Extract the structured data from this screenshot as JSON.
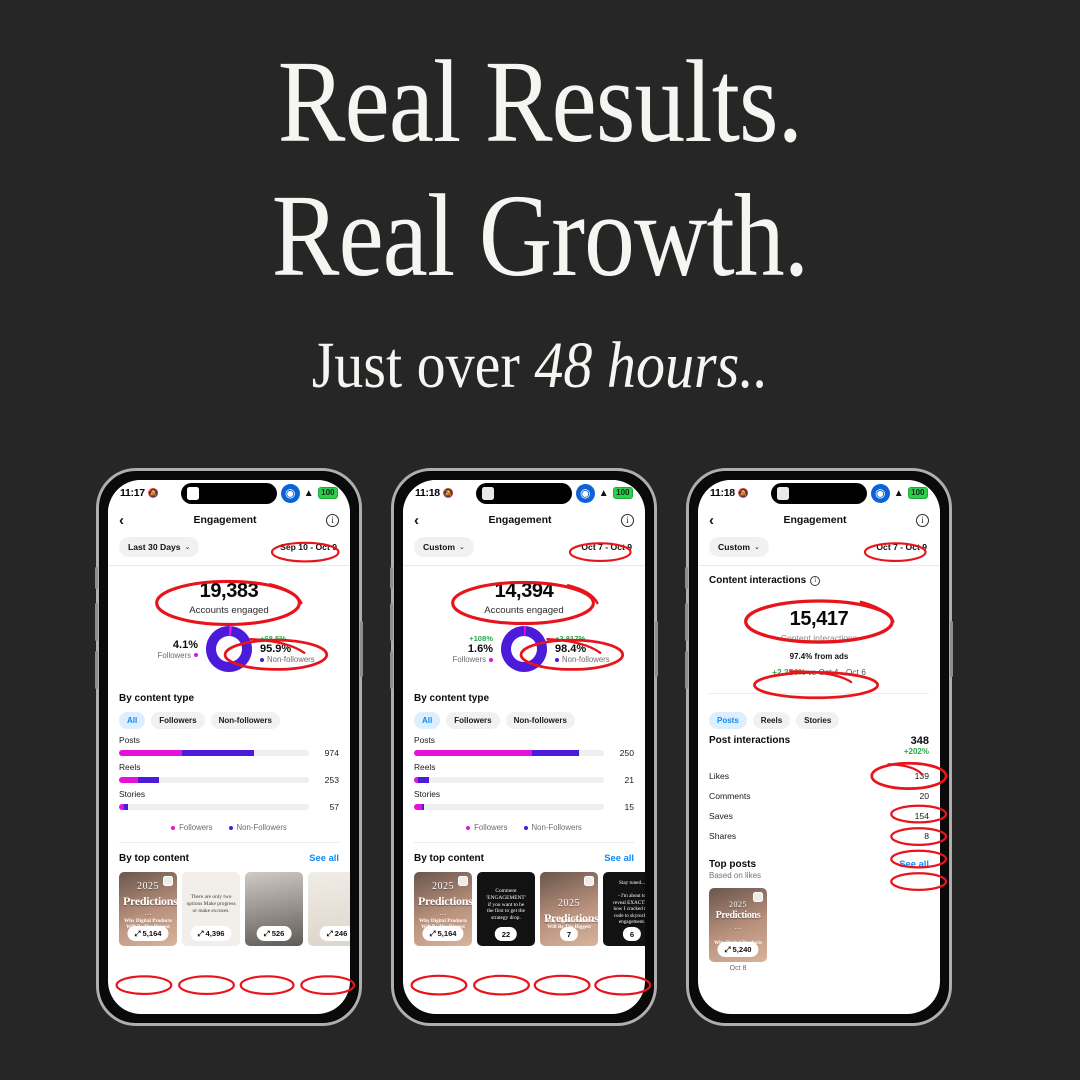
{
  "headline": {
    "line1": "Real Results.",
    "line2": "Real Growth.",
    "sub_prefix": "Just over ",
    "sub_emphasis": "48 hours.."
  },
  "colors": {
    "background": "#262626",
    "annotation": "#e8141b",
    "magenta": "#e612d9",
    "blue": "#4b1bd9",
    "green": "#2aa84a",
    "link": "#0b8bf5"
  },
  "phones": [
    {
      "status": {
        "time": "11:17",
        "mute_icon": "mute-bell-icon",
        "airdrop_icon": "airdrop-icon",
        "wifi_icon": "wifi-icon",
        "battery": "100"
      },
      "nav": {
        "back_icon": "chevron-left-icon",
        "title": "Engagement",
        "info_icon": "info-icon"
      },
      "filter": {
        "preset": "Last 30 Days",
        "chevron": "chevron-down-icon",
        "date_range": "Sep 10 - Oct 9"
      },
      "hero": {
        "value": "19,383",
        "label": "Accounts engaged"
      },
      "donut": {
        "left": {
          "pct": "4.1%",
          "label": "Followers",
          "delta": ""
        },
        "right": {
          "pct": "95.9%",
          "label": "Non-followers",
          "delta": "+68.5%"
        },
        "followers_share": 4.1
      },
      "content_type": {
        "title": "By content type",
        "tabs": [
          "All",
          "Followers",
          "Non-followers"
        ],
        "active_tab": "All",
        "rows": [
          {
            "label": "Posts",
            "value": "974",
            "followers_pct": 33,
            "nonfollowers_pct": 38
          },
          {
            "label": "Reels",
            "value": "253",
            "followers_pct": 10,
            "nonfollowers_pct": 11
          },
          {
            "label": "Stories",
            "value": "57",
            "followers_pct": 2.5,
            "nonfollowers_pct": 2
          }
        ],
        "legend": [
          "Followers",
          "Non-Followers"
        ]
      },
      "top_content": {
        "title": "By top content",
        "see_all": "See all",
        "items": [
          {
            "style": "t-predict",
            "big": "2025",
            "big2": "Predictions",
            "sub": "Why Digital Products Will Be The Biggest",
            "badge": "5,164",
            "trend_icon": "trend-up-icon",
            "carousel": true
          },
          {
            "style": "t-light",
            "text": "There are only two options\nMake progress or\nmake excuses.",
            "badge": "4,396",
            "trend_icon": "trend-up-icon",
            "carousel": false
          },
          {
            "style": "t-photo",
            "text": "",
            "badge": "526",
            "trend_icon": "trend-up-icon",
            "carousel": false
          },
          {
            "style": "t-room",
            "text": "",
            "badge": "246",
            "trend_icon": "trend-up-icon",
            "carousel": false
          },
          {
            "style": "t-room",
            "text": "",
            "badge": "",
            "trend_icon": "",
            "carousel": false
          }
        ]
      }
    },
    {
      "status": {
        "time": "11:18",
        "mute_icon": "mute-bell-icon",
        "airdrop_icon": "airdrop-icon",
        "wifi_icon": "wifi-icon",
        "battery": "100"
      },
      "nav": {
        "back_icon": "chevron-left-icon",
        "title": "Engagement",
        "info_icon": "info-icon"
      },
      "filter": {
        "preset": "Custom",
        "chevron": "chevron-down-icon",
        "date_range": "Oct 7 - Oct 9"
      },
      "hero": {
        "value": "14,394",
        "label": "Accounts engaged"
      },
      "donut": {
        "left": {
          "pct": "1.6%",
          "label": "Followers",
          "delta": "+108%"
        },
        "right": {
          "pct": "98.4%",
          "label": "Non-followers",
          "delta": "+3,817%"
        },
        "followers_share": 1.6
      },
      "content_type": {
        "title": "By content type",
        "tabs": [
          "All",
          "Followers",
          "Non-followers"
        ],
        "active_tab": "All",
        "rows": [
          {
            "label": "Posts",
            "value": "250",
            "followers_pct": 62,
            "nonfollowers_pct": 25
          },
          {
            "label": "Reels",
            "value": "21",
            "followers_pct": 2,
            "nonfollowers_pct": 6
          },
          {
            "label": "Stories",
            "value": "15",
            "followers_pct": 4,
            "nonfollowers_pct": 1.5
          }
        ],
        "legend": [
          "Followers",
          "Non-Followers"
        ]
      },
      "top_content": {
        "title": "By top content",
        "see_all": "See all",
        "items": [
          {
            "style": "t-predict",
            "big": "2025",
            "big2": "Predictions",
            "sub": "Why Digital Products Will Be The Biggest",
            "badge": "5,164",
            "trend_icon": "trend-up-icon",
            "carousel": true
          },
          {
            "style": "t-dark",
            "text": "Comment\n'ENGAGEMENT'\nif you want to be\nthe first to get the\nstrategy drop.",
            "badge": "22",
            "trend_icon": "",
            "carousel": false
          },
          {
            "style": "t-predict2",
            "big": "2025",
            "big2": "Predictions",
            "sub": "Why Digital Products Will Be The Biggest",
            "badge": "7",
            "trend_icon": "",
            "carousel": true
          },
          {
            "style": "t-dark",
            "text": "Stay tuned...\n\n- I'm about to\nreveal EXACTLY\nhow I cracked the\ncode to skyrocket\nengagement.",
            "badge": "6",
            "trend_icon": "",
            "carousel": false
          },
          {
            "style": "t-dark",
            "text": "",
            "badge": "",
            "trend_icon": "",
            "carousel": false
          }
        ]
      }
    },
    {
      "status": {
        "time": "11:18",
        "mute_icon": "mute-bell-icon",
        "airdrop_icon": "airdrop-icon",
        "wifi_icon": "wifi-icon",
        "battery": "100"
      },
      "nav": {
        "back_icon": "chevron-left-icon",
        "title": "Engagement",
        "info_icon": "info-icon"
      },
      "filter": {
        "preset": "Custom",
        "chevron": "chevron-down-icon",
        "date_range": "Oct 7 - Oct 9"
      },
      "content_interactions": {
        "title": "Content interactions",
        "info_icon": "info-icon",
        "value": "15,417",
        "label": "Content interactions",
        "from_ads": "97.4% from ads",
        "delta": "+2,354%",
        "vs_text": " vs Oct 4 - Oct 6"
      },
      "tabs": [
        "Posts",
        "Reels",
        "Stories"
      ],
      "active_tab": "Posts",
      "post_interactions": {
        "label": "Post interactions",
        "value": "348",
        "delta": "+202%",
        "rows": [
          {
            "label": "Likes",
            "value": "139"
          },
          {
            "label": "Comments",
            "value": "20"
          },
          {
            "label": "Saves",
            "value": "154"
          },
          {
            "label": "Shares",
            "value": "8"
          }
        ]
      },
      "top_posts": {
        "title": "Top posts",
        "subtitle": "Based on likes",
        "see_all": "See all",
        "items": [
          {
            "style": "t-predict",
            "big": "2025",
            "big2": "Predictions",
            "sub": "Why Digital Products",
            "badge": "5,240",
            "trend_icon": "trend-up-icon",
            "carousel": true,
            "caption": "Oct 8"
          }
        ]
      }
    }
  ]
}
